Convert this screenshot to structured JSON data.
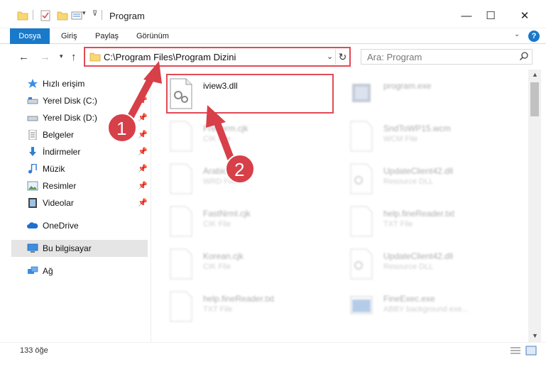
{
  "window": {
    "title": "Program",
    "min_glyph": "—",
    "max_glyph": "☐",
    "close_glyph": "✕"
  },
  "ribbon": {
    "tabs": [
      "Dosya",
      "Giriş",
      "Paylaş",
      "Görünüm"
    ],
    "help_glyph": "?"
  },
  "address": {
    "path": "C:\\Program Files\\Program Dizini"
  },
  "search": {
    "placeholder": "Ara: Program"
  },
  "nav_pane": {
    "items": [
      {
        "label": "Hızlı erişim",
        "icon": "star-icon",
        "pinned": false
      },
      {
        "label": "Yerel Disk (C:)",
        "icon": "drive-icon",
        "pinned": true
      },
      {
        "label": "Yerel Disk (D:)",
        "icon": "drive-icon",
        "pinned": true
      },
      {
        "label": "Belgeler",
        "icon": "documents-icon",
        "pinned": true
      },
      {
        "label": "İndirmeler",
        "icon": "download-icon",
        "pinned": true
      },
      {
        "label": "Müzik",
        "icon": "music-icon",
        "pinned": true
      },
      {
        "label": "Resimler",
        "icon": "pictures-icon",
        "pinned": true
      },
      {
        "label": "Videolar",
        "icon": "videos-icon",
        "pinned": true
      },
      {
        "label": "OneDrive",
        "icon": "cloud-icon",
        "pinned": false
      },
      {
        "label": "Bu bilgisayar",
        "icon": "computer-icon",
        "pinned": false,
        "selected": true
      },
      {
        "label": "Ağ",
        "icon": "network-icon",
        "pinned": false
      }
    ]
  },
  "files": [
    {
      "name": "iview3.dll",
      "type": "",
      "icon": "dll-file-icon",
      "highlighted": true
    },
    {
      "name": "program.exe",
      "type": "",
      "icon": "exe-file-icon",
      "faded": true
    },
    {
      "name": "Frenorm.cjk",
      "type": "CIK File",
      "icon": "blank-file-icon",
      "faded": true
    },
    {
      "name": "SndToWP15.wcm",
      "type": "WCM File",
      "icon": "blank-file-icon",
      "faded": true
    },
    {
      "name": "Arabic...",
      "type": "WRD File",
      "icon": "blank-file-icon",
      "faded": true
    },
    {
      "name": "UpdateClient42.dll",
      "type": "Resource DLL",
      "icon": "dll-file-icon",
      "faded": true
    },
    {
      "name": "FastNrml.cjk",
      "type": "CIK File",
      "icon": "blank-file-icon",
      "faded": true
    },
    {
      "name": "help.fineReader.txt",
      "type": "TXT File",
      "icon": "blank-file-icon",
      "faded": true
    },
    {
      "name": "Korean.cjk",
      "type": "CIK File",
      "icon": "blank-file-icon",
      "faded": true
    },
    {
      "name": "UpdateClient42.dll",
      "type": "Resource DLL",
      "icon": "dll-file-icon",
      "faded": true
    },
    {
      "name": "help.fineReader.txt",
      "type": "TXT File",
      "icon": "blank-file-icon",
      "faded": true
    },
    {
      "name": "FineExec.exe",
      "type": "ABBY background exe...",
      "icon": "exe-file-icon",
      "faded": true
    }
  ],
  "status": {
    "count": "133 öğe"
  },
  "annotations": {
    "step1": "1",
    "step2": "2",
    "color": "#e24a55"
  }
}
